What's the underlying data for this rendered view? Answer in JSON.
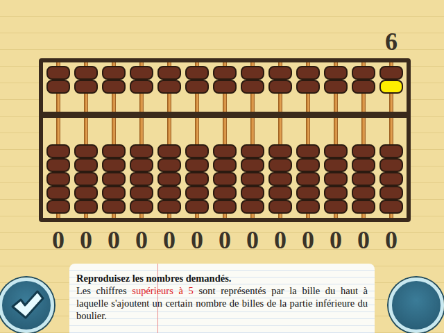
{
  "target": "6",
  "rods": [
    {
      "digit": "0",
      "upper": [
        false,
        false
      ],
      "lower": [
        false,
        false,
        false,
        false,
        false
      ]
    },
    {
      "digit": "0",
      "upper": [
        false,
        false
      ],
      "lower": [
        false,
        false,
        false,
        false,
        false
      ]
    },
    {
      "digit": "0",
      "upper": [
        false,
        false
      ],
      "lower": [
        false,
        false,
        false,
        false,
        false
      ]
    },
    {
      "digit": "0",
      "upper": [
        false,
        false
      ],
      "lower": [
        false,
        false,
        false,
        false,
        false
      ]
    },
    {
      "digit": "0",
      "upper": [
        false,
        false
      ],
      "lower": [
        false,
        false,
        false,
        false,
        false
      ]
    },
    {
      "digit": "0",
      "upper": [
        false,
        false
      ],
      "lower": [
        false,
        false,
        false,
        false,
        false
      ]
    },
    {
      "digit": "0",
      "upper": [
        false,
        false
      ],
      "lower": [
        false,
        false,
        false,
        false,
        false
      ]
    },
    {
      "digit": "0",
      "upper": [
        false,
        false
      ],
      "lower": [
        false,
        false,
        false,
        false,
        false
      ]
    },
    {
      "digit": "0",
      "upper": [
        false,
        false
      ],
      "lower": [
        false,
        false,
        false,
        false,
        false
      ]
    },
    {
      "digit": "0",
      "upper": [
        false,
        false
      ],
      "lower": [
        false,
        false,
        false,
        false,
        false
      ]
    },
    {
      "digit": "0",
      "upper": [
        false,
        false
      ],
      "lower": [
        false,
        false,
        false,
        false,
        false
      ]
    },
    {
      "digit": "0",
      "upper": [
        false,
        false
      ],
      "lower": [
        false,
        false,
        false,
        false,
        false
      ]
    },
    {
      "digit": "0",
      "upper": [
        false,
        true
      ],
      "lower": [
        false,
        false,
        false,
        false,
        false
      ]
    }
  ],
  "instruction": {
    "title": "Reproduisez les nombres demandés.",
    "segments": [
      {
        "text": "Les chiffres ",
        "highlight": false
      },
      {
        "text": "supérieurs à 5",
        "highlight": true
      },
      {
        "text": " sont représentés par la bille du haut à laquelle s'ajoutent un certain nombre de billes de la partie inférieure du boulier.",
        "highlight": false
      }
    ]
  },
  "buttons": [
    {
      "kind": "check"
    },
    {
      "kind": "blank"
    }
  ]
}
